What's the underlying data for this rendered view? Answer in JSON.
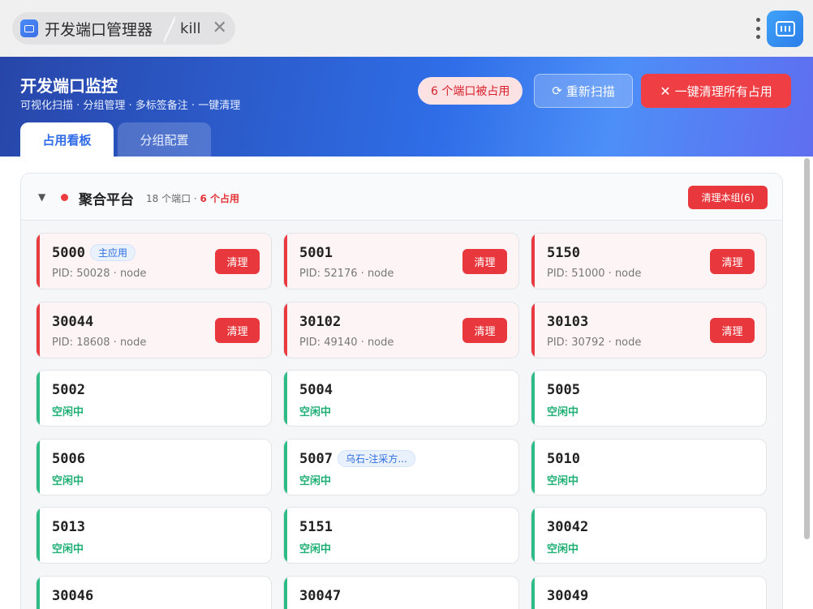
{
  "window": {
    "tab_title": "开发端口管理器",
    "sub_tab": "kill"
  },
  "header": {
    "title": "开发端口监控",
    "subtitle": "可视化扫描 · 分组管理 · 多标签备注 · 一键清理",
    "busy_count_label": "6 个端口被占用",
    "rescan_label": "重新扫描",
    "kill_all_label": "一键清理所有占用",
    "tabs": [
      {
        "label": "占用看板",
        "active": true
      },
      {
        "label": "分组配置",
        "active": false
      }
    ]
  },
  "group": {
    "name": "聚合平台",
    "ports_count": "18 个端口 · ",
    "busy_count": "6 个占用",
    "clear_label": "清理本组(6)",
    "status_color": "#ee3b3f",
    "ports": [
      {
        "port": "5000",
        "tag": "主应用",
        "status": "busy",
        "info": "PID: 50028 · node",
        "action": "清理"
      },
      {
        "port": "5001",
        "status": "busy",
        "info": "PID: 52176 · node",
        "action": "清理"
      },
      {
        "port": "5150",
        "status": "busy",
        "info": "PID: 51000 · node",
        "action": "清理"
      },
      {
        "port": "30044",
        "status": "busy",
        "info": "PID: 18608 · node",
        "action": "清理"
      },
      {
        "port": "30102",
        "status": "busy",
        "info": "PID: 49140 · node",
        "action": "清理"
      },
      {
        "port": "30103",
        "status": "busy",
        "info": "PID: 30792 · node",
        "action": "清理"
      },
      {
        "port": "5002",
        "status": "free",
        "info": "空闲中"
      },
      {
        "port": "5004",
        "status": "free",
        "info": "空闲中"
      },
      {
        "port": "5005",
        "status": "free",
        "info": "空闲中"
      },
      {
        "port": "5006",
        "status": "free",
        "info": "空闲中"
      },
      {
        "port": "5007",
        "tag": "乌石-注采方...",
        "status": "free",
        "info": "空闲中"
      },
      {
        "port": "5010",
        "status": "free",
        "info": "空闲中"
      },
      {
        "port": "5013",
        "status": "free",
        "info": "空闲中"
      },
      {
        "port": "5151",
        "status": "free",
        "info": "空闲中"
      },
      {
        "port": "30042",
        "status": "free",
        "info": "空闲中"
      },
      {
        "port": "30046",
        "status": "free",
        "info": ""
      },
      {
        "port": "30047",
        "status": "free",
        "info": ""
      },
      {
        "port": "30049",
        "status": "free",
        "info": ""
      }
    ]
  },
  "colors": {
    "busy": "#e83a3f",
    "free": "#2dbc86",
    "accent": "#2f6be8"
  }
}
